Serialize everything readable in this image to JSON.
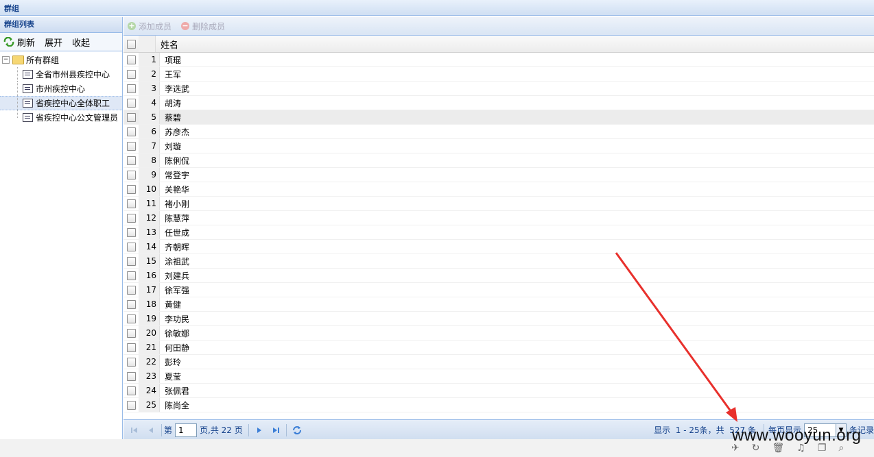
{
  "window": {
    "title": "群组"
  },
  "left": {
    "title": "群组列表",
    "tools": {
      "refresh": "刷新",
      "expand": "展开",
      "collapse": "收起"
    },
    "tree": {
      "root": "所有群组",
      "children": [
        "全省市州县疾控中心",
        "市州疾控中心",
        "省疾控中心全体职工",
        "省疾控中心公文管理员"
      ],
      "selected_index": 2
    }
  },
  "main": {
    "toolbar": {
      "add": "添加成员",
      "remove": "删除成员"
    },
    "grid": {
      "header": "姓名",
      "rows": [
        {
          "n": "1",
          "name": "项琨"
        },
        {
          "n": "2",
          "name": "王军"
        },
        {
          "n": "3",
          "name": "李选武"
        },
        {
          "n": "4",
          "name": "胡涛"
        },
        {
          "n": "5",
          "name": "蔡碧"
        },
        {
          "n": "6",
          "name": "苏彦杰"
        },
        {
          "n": "7",
          "name": "刘璇"
        },
        {
          "n": "8",
          "name": "陈俐侃"
        },
        {
          "n": "9",
          "name": "常登宇"
        },
        {
          "n": "10",
          "name": "关艳华"
        },
        {
          "n": "11",
          "name": "褚小刚"
        },
        {
          "n": "12",
          "name": "陈慧萍"
        },
        {
          "n": "13",
          "name": "任世成"
        },
        {
          "n": "14",
          "name": "齐朝晖"
        },
        {
          "n": "15",
          "name": "涂祖武"
        },
        {
          "n": "16",
          "name": "刘建兵"
        },
        {
          "n": "17",
          "name": "徐军强"
        },
        {
          "n": "18",
          "name": "黄健"
        },
        {
          "n": "19",
          "name": "李功民"
        },
        {
          "n": "20",
          "name": "徐敏娜"
        },
        {
          "n": "21",
          "name": "何田静"
        },
        {
          "n": "22",
          "name": "彭玲"
        },
        {
          "n": "23",
          "name": "夏莹"
        },
        {
          "n": "24",
          "name": "张佩君"
        },
        {
          "n": "25",
          "name": "陈尚全"
        }
      ],
      "highlighted_row": 5
    },
    "pager": {
      "page_prefix": "第",
      "page_value": "1",
      "page_suffix": "页,共 22 页",
      "display": "显示  1 - 25条，共  527 条",
      "per_page_label": "每页显示",
      "per_page_value": "25",
      "records_label": "条记录"
    }
  },
  "watermark": "www.wooyun.org",
  "colors": {
    "header_blue": "#15428b",
    "border_blue": "#99bbe8",
    "arrow_red": "#e8302c"
  }
}
